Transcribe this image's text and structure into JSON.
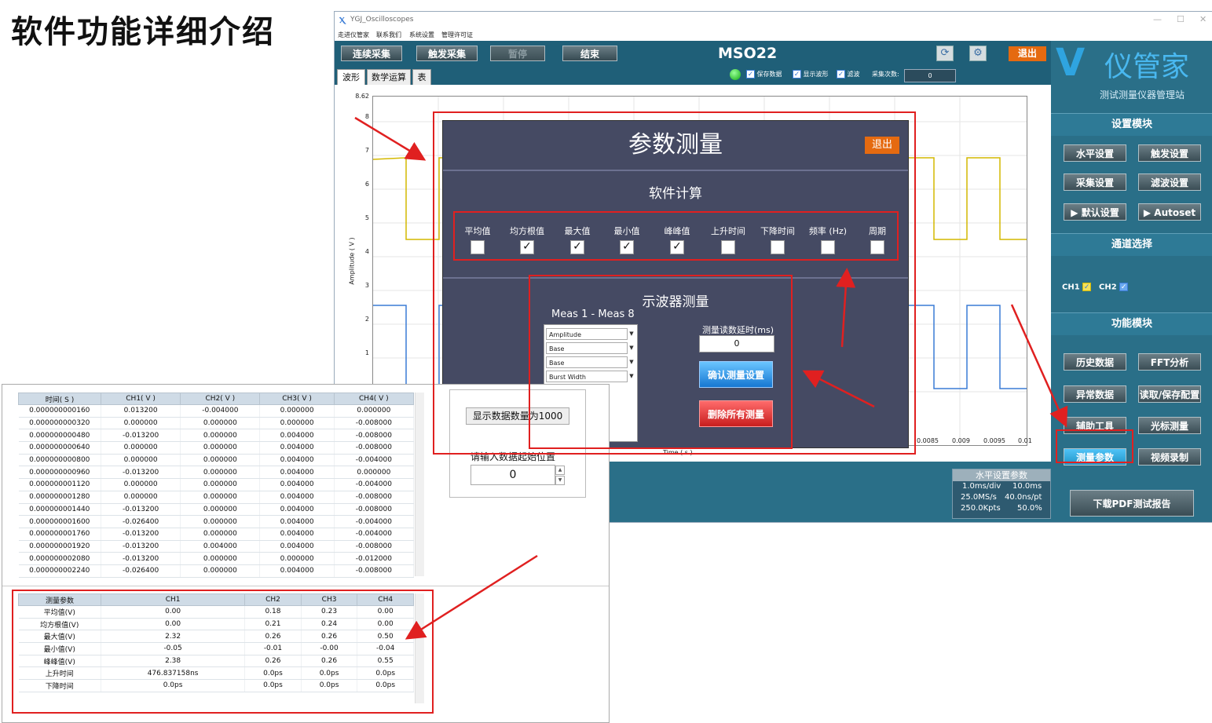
{
  "page_title": "软件功能详细介绍",
  "app": {
    "window_title": "YGJ_Oscilloscopes",
    "menu": [
      "走进仪管家",
      "联系我们",
      "系统设置",
      "管理许可证"
    ],
    "toolbar": {
      "continuous": "连续采集",
      "trigger": "触发采集",
      "pause": "暂停",
      "end": "结束",
      "model": "MSO22",
      "exit": "退出"
    },
    "tabs": [
      "波形",
      "数学运算",
      "表"
    ],
    "options": {
      "save_data": "保存数据",
      "show_wave": "显示波形",
      "filter": "滤波",
      "count_label": "采集次数:",
      "count_value": "0"
    },
    "plot": {
      "ylabel": "Amplitude ( V )",
      "xlabel": "Time ( s )",
      "yticks": [
        "8.62",
        "8",
        "7",
        "6",
        "5",
        "4",
        "3",
        "2",
        "1"
      ],
      "xticks": [
        "0.0085",
        "0.009",
        "0.0095",
        "0.01"
      ]
    },
    "hparams": {
      "title": "水平设置参数",
      "div": "1.0ms/div",
      "len": "10.0ms",
      "rate": "25.0MS/s",
      "per_pt": "40.0ns/pt",
      "pts": "250.0Kpts",
      "pct": "50.0%"
    },
    "right": {
      "brand": "仪管家",
      "brand_sub": "测试测量仪器管理站",
      "settings_title": "设置模块",
      "settings_buttons": [
        "水平设置",
        "触发设置",
        "采集设置",
        "滤波设置",
        "▶ 默认设置",
        "▶ Autoset"
      ],
      "channel_title": "通道选择",
      "ch1": "CH1",
      "ch2": "CH2",
      "function_title": "功能模块",
      "function_buttons": [
        "历史数据",
        "FFT分析",
        "异常数据",
        "读取/保存配置",
        "辅助工具",
        "光标测量",
        "测量参数",
        "视频录制"
      ],
      "pdf": "下载PDF测试报告"
    },
    "modal": {
      "title": "参数测量",
      "exit": "退出",
      "calc_title": "软件计算",
      "items": [
        {
          "label": "平均值",
          "checked": false
        },
        {
          "label": "均方根值",
          "checked": true
        },
        {
          "label": "最大值",
          "checked": true
        },
        {
          "label": "最小值",
          "checked": true
        },
        {
          "label": "峰峰值",
          "checked": true
        },
        {
          "label": "上升时间",
          "checked": false
        },
        {
          "label": "下降时间",
          "checked": false
        },
        {
          "label": "频率 (Hz)",
          "checked": false
        },
        {
          "label": "周期",
          "checked": false
        }
      ],
      "osc_title": "示波器测量",
      "meas_range": "Meas 1 - Meas 8",
      "meas_items": [
        "Amplitude",
        "Base",
        "Base",
        "Burst Width"
      ],
      "delay_label": "测量读数延时(ms)",
      "delay_value": "0",
      "confirm": "确认测量设置",
      "delete": "删除所有测量"
    }
  },
  "data_window": {
    "headers": [
      "时间( S )",
      "CH1( V )",
      "CH2( V )",
      "CH3( V )",
      "CH4( V )"
    ],
    "rows": [
      [
        "0.000000000160",
        "0.013200",
        "-0.004000",
        "0.000000",
        "0.000000"
      ],
      [
        "0.000000000320",
        "0.000000",
        "0.000000",
        "0.000000",
        "-0.008000"
      ],
      [
        "0.000000000480",
        "-0.013200",
        "0.000000",
        "0.004000",
        "-0.008000"
      ],
      [
        "0.000000000640",
        "0.000000",
        "0.000000",
        "0.004000",
        "-0.008000"
      ],
      [
        "0.000000000800",
        "0.000000",
        "0.000000",
        "0.004000",
        "-0.004000"
      ],
      [
        "0.000000000960",
        "-0.013200",
        "0.000000",
        "0.004000",
        "0.000000"
      ],
      [
        "0.000000001120",
        "0.000000",
        "0.000000",
        "0.004000",
        "-0.004000"
      ],
      [
        "0.000000001280",
        "0.000000",
        "0.000000",
        "0.004000",
        "-0.008000"
      ],
      [
        "0.000000001440",
        "-0.013200",
        "0.000000",
        "0.004000",
        "-0.008000"
      ],
      [
        "0.000000001600",
        "-0.026400",
        "0.000000",
        "0.004000",
        "-0.004000"
      ],
      [
        "0.000000001760",
        "-0.013200",
        "0.000000",
        "0.004000",
        "-0.004000"
      ],
      [
        "0.000000001920",
        "-0.013200",
        "0.004000",
        "0.004000",
        "-0.008000"
      ],
      [
        "0.000000002080",
        "-0.013200",
        "0.000000",
        "0.000000",
        "-0.012000"
      ],
      [
        "0.000000002240",
        "-0.026400",
        "0.000000",
        "0.004000",
        "-0.008000"
      ]
    ],
    "count_button": "显示数据数量为1000",
    "start_label": "请输入数据起始位置",
    "start_value": "0",
    "meas_headers": [
      "测量参数",
      "CH1",
      "CH2",
      "CH3",
      "CH4"
    ],
    "meas_rows": [
      [
        "平均值(V)",
        "0.00",
        "0.18",
        "0.23",
        "0.00"
      ],
      [
        "均方根值(V)",
        "0.00",
        "0.21",
        "0.24",
        "0.00"
      ],
      [
        "最大值(V)",
        "2.32",
        "0.26",
        "0.26",
        "0.50"
      ],
      [
        "最小值(V)",
        "-0.05",
        "-0.01",
        "-0.00",
        "-0.04"
      ],
      [
        "峰峰值(V)",
        "2.38",
        "0.26",
        "0.26",
        "0.55"
      ],
      [
        "上升时间",
        "476.837158ns",
        "0.0ps",
        "0.0ps",
        "0.0ps"
      ],
      [
        "下降时间",
        "0.0ps",
        "0.0ps",
        "0.0ps",
        "0.0ps"
      ]
    ]
  },
  "colors": {
    "ch1": "#d4b800",
    "ch2": "#3a7bd5",
    "annotation": "#e02020",
    "app_bg": "#2a6f88",
    "modal_bg": "#454a63"
  }
}
